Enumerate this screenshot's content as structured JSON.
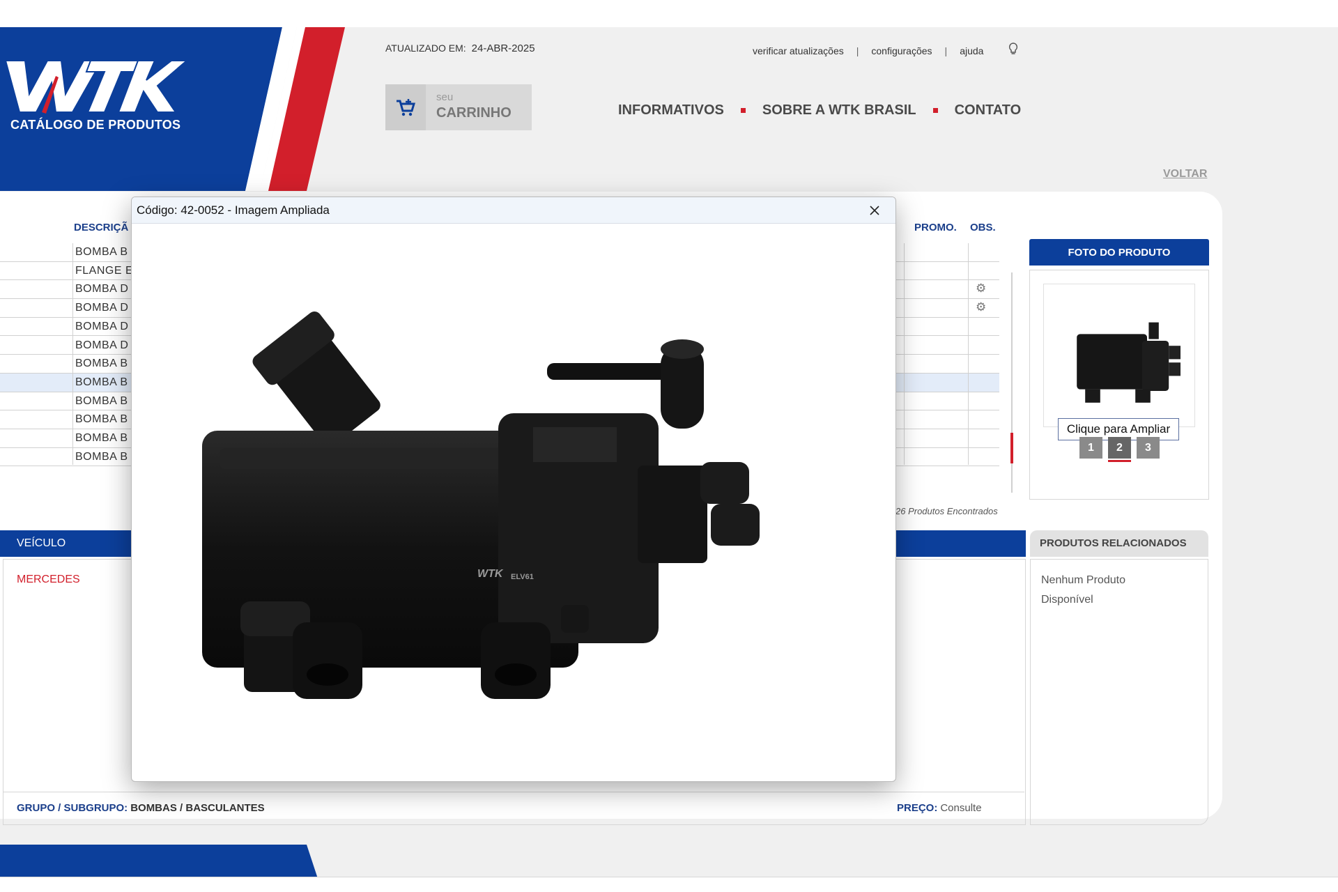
{
  "header": {
    "logo_text": "WTK",
    "logo_subtitle": "CATÁLOGO DE PRODUTOS",
    "updated_label": "ATUALIZADO EM:",
    "updated_date": "24-ABR-2025",
    "top_links": [
      "verificar atualizações",
      "configurações",
      "ajuda"
    ],
    "separator": "|",
    "cart_small": "seu",
    "cart_big": "CARRINHO",
    "nav": [
      "INFORMATIVOS",
      "SOBRE A WTK BRASIL",
      "CONTATO"
    ],
    "back_label": "VOLTAR"
  },
  "table": {
    "headers": {
      "descricao": "DESCRIÇÃ",
      "promo": "PROMO.",
      "obs": "OBS."
    },
    "rows": [
      {
        "desc": "BOMBA B",
        "obs": false
      },
      {
        "desc": "FLANGE E",
        "obs": false
      },
      {
        "desc": "BOMBA D",
        "obs": true
      },
      {
        "desc": "BOMBA D",
        "obs": true
      },
      {
        "desc": "BOMBA D",
        "obs": false
      },
      {
        "desc": "BOMBA D",
        "obs": false
      },
      {
        "desc": "BOMBA B",
        "obs": false
      },
      {
        "desc": "BOMBA B",
        "obs": false,
        "selected": true
      },
      {
        "desc": "BOMBA B",
        "obs": false
      },
      {
        "desc": "BOMBA B",
        "obs": false
      },
      {
        "desc": "BOMBA B",
        "obs": false
      },
      {
        "desc": "BOMBA B",
        "obs": false
      }
    ],
    "obs_icon": "gear-icon",
    "found_text": "26 Produtos Encontrados"
  },
  "photo": {
    "header": "FOTO DO PRODUTO",
    "tooltip": "Clique para Ampliar",
    "pages": [
      "1",
      "2",
      "3"
    ],
    "active_page": "2"
  },
  "vehicle": {
    "header": "VEÍCULO",
    "items": [
      "MERCEDES"
    ],
    "group_label": "GRUPO / SUBGRUPO:",
    "group_value": "BOMBAS / BASCULANTES",
    "price_label": "PREÇO:",
    "price_value": "Consulte"
  },
  "related": {
    "header": "PRODUTOS RELACIONADOS",
    "empty_text": "Nenhum Produto Disponível"
  },
  "modal": {
    "title": "Código: 42-0052 - Imagem Ampliada",
    "product_marking": "WTK",
    "product_code_mark": "ELV61"
  },
  "colors": {
    "brand_blue": "#0c3f9b",
    "brand_red": "#d21f2b",
    "selected_row": "#e3ecf9"
  }
}
